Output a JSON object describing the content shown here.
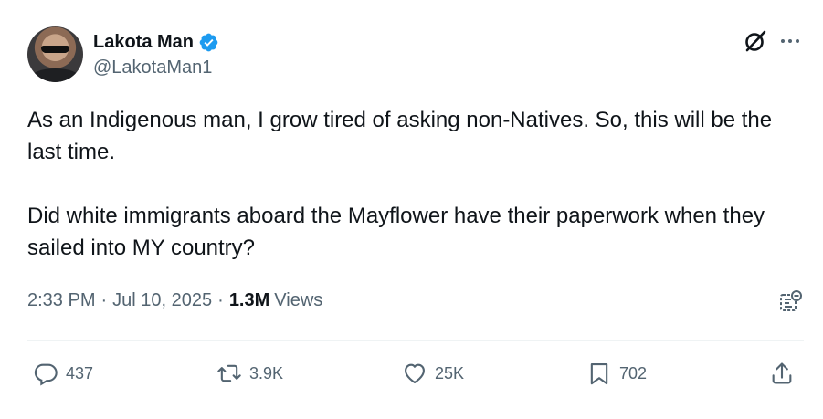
{
  "author": {
    "display_name": "Lakota Man",
    "handle": "@LakotaMan1",
    "verified": true,
    "verified_color": "#1d9bf0"
  },
  "tweet": {
    "paragraphs": [
      "As an Indigenous man, I grow tired of asking non-Natives. So, this will be the last time.",
      "Did white immigrants aboard the Mayflower have their paperwork when they sailed into MY country?"
    ],
    "time": "2:33 PM",
    "date": "Jul 10, 2025",
    "views_count": "1.3M",
    "views_label": "Views"
  },
  "actions": {
    "replies": "437",
    "reposts": "3.9K",
    "likes": "25K",
    "bookmarks": "702"
  },
  "icons": {
    "grok": "grok-icon",
    "more": "more-icon",
    "analytics": "analytics-icon",
    "reply": "reply-icon",
    "repost": "repost-icon",
    "like": "heart-icon",
    "bookmark": "bookmark-icon",
    "share": "share-icon"
  },
  "colors": {
    "text": "#0f1419",
    "secondary": "#536471",
    "divider": "#eff3f4"
  }
}
